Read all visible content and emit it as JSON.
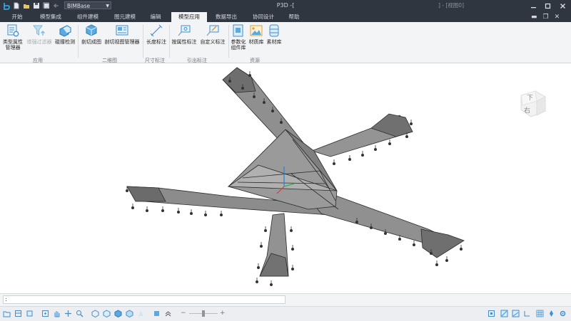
{
  "titlebar": {
    "app_title": "P3D -[",
    "right_status": "] - [视图0]",
    "project_combo": "BIMBase"
  },
  "menu": {
    "tabs": [
      "开始",
      "模型集成",
      "组件建模",
      "图元建模",
      "编辑",
      "模型应用",
      "数据导出",
      "协同设计",
      "帮助"
    ],
    "active_tab": "模型应用"
  },
  "ribbon": {
    "buttons": {
      "type_attr": "类型属性\n管理器",
      "enhanced_filter": "增强过滤器",
      "clash_detect": "碰撞检测",
      "section_drawing": "剖切成图",
      "section_view_mgr": "剖切视图管理器",
      "length_dim": "长度标注",
      "attr_annotate": "按属性标注",
      "custom_annotate": "自定义标注",
      "param_component_lib": "参数化\n组件库",
      "material_lib": "材质库",
      "texture_lib": "素材库"
    },
    "groups": {
      "apply": "应用",
      "drawing2d": "二维图",
      "dimension": "尺寸标注",
      "leader": "引出标注",
      "resource": "资源"
    }
  },
  "viewcube": {
    "top_face": "下",
    "front_face": "右"
  },
  "cmdline": {
    "value": ":"
  },
  "statusbar": {
    "zoom_minus": "−",
    "zoom_plus": "+",
    "zoom_level": 0.5
  }
}
